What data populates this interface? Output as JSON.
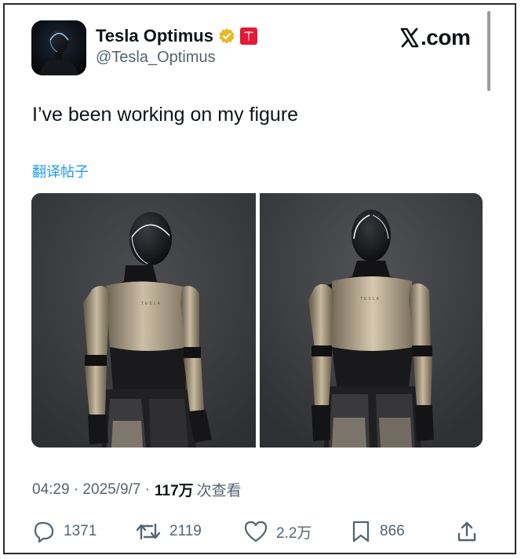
{
  "post": {
    "author_name": "Tesla Optimus",
    "handle": "@Tesla_Optimus",
    "site_label": ".com",
    "text": "I’ve been working on my figure",
    "translate_link": "翻译帖子",
    "timestamp": "04:29 · 2025/9/7 ·",
    "views_count": "117万",
    "views_label": "次查看"
  },
  "actions": {
    "replies": "1371",
    "reposts": "2119",
    "likes": "2.2万",
    "bookmarks": "866"
  },
  "icons": {
    "verified": "verified-badge-icon",
    "brand": "tesla-logo-icon",
    "reply": "reply-icon",
    "repost": "repost-icon",
    "like": "heart-icon",
    "bookmark": "bookmark-icon",
    "share": "share-icon"
  },
  "colors": {
    "verified_gold": "#e8b829",
    "brand_red": "#e31937",
    "link_blue": "#1d9bf0",
    "muted_text": "#536471"
  }
}
